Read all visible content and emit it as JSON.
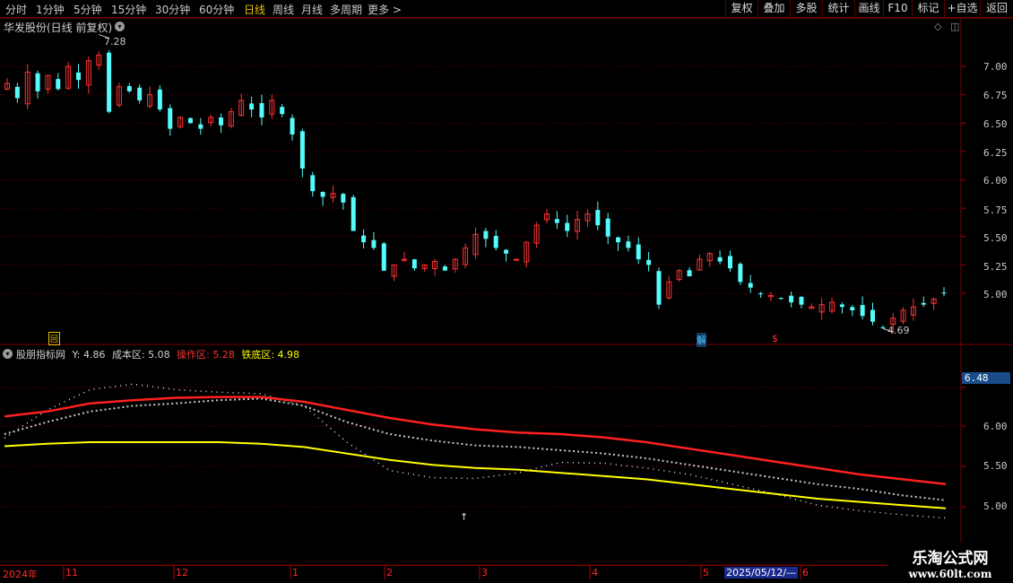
{
  "toolbar": {
    "periods": [
      "分时",
      "1分钟",
      "5分钟",
      "15分钟",
      "30分钟",
      "60分钟",
      "日线",
      "周线",
      "月线",
      "多周期",
      "更多 >"
    ],
    "active_period": "日线",
    "right_buttons": [
      "复权",
      "叠加",
      "多股",
      "统计",
      "画线",
      "F10",
      "标记",
      "+自选",
      "返回"
    ]
  },
  "chart_title": "华发股份(日线 前复权)",
  "price_axis": [
    "7.00",
    "6.75",
    "6.50",
    "6.25",
    "6.00",
    "5.75",
    "5.50",
    "5.25",
    "5.00"
  ],
  "annotations": {
    "high": "7.28",
    "low": "4.69",
    "marker_jie": "解",
    "marker_dollar": "$",
    "marker_box": "回"
  },
  "indicator": {
    "name": "股朋指标网",
    "y_label": "Y: 4.86",
    "cost_label": "成本区: 5.08",
    "op_label": "操作区: 5.28",
    "iron_label": "铁底区: 4.98",
    "axis": [
      "6.48",
      "6.00",
      "5.50",
      "5.00"
    ],
    "current_value": "6.48",
    "arrow": "↑"
  },
  "date_axis": {
    "labels": [
      "2024年",
      "11",
      "12",
      "1",
      "2",
      "3",
      "4",
      "5",
      "6"
    ],
    "cursor_date": "2025/05/12/—"
  },
  "watermark": {
    "line1": "乐淘公式网",
    "line2": "www.60lt.com"
  },
  "colors": {
    "up": "#ff3232",
    "down": "#54fcfc",
    "op_line": "#ff2020",
    "iron_line": "#ffff00",
    "grid": "#7a0000"
  },
  "chart_data": {
    "type": "candlestick",
    "title": "华发股份(日线 前复权)",
    "close_series": [
      6.85,
      6.72,
      6.95,
      6.78,
      6.92,
      6.8,
      7.0,
      6.88,
      7.05,
      7.1,
      6.6,
      6.82,
      6.78,
      6.7,
      6.75,
      6.62,
      6.45,
      6.55,
      6.5,
      6.45,
      6.55,
      6.48,
      6.6,
      6.7,
      6.62,
      6.55,
      6.7,
      6.58,
      6.4,
      6.1,
      5.9,
      5.85,
      5.88,
      5.8,
      5.55,
      5.45,
      5.4,
      5.2,
      5.25,
      5.3,
      5.22,
      5.25,
      5.28,
      5.2,
      5.3,
      5.4,
      5.52,
      5.48,
      5.4,
      5.35,
      5.3,
      5.45,
      5.6,
      5.7,
      5.62,
      5.55,
      5.65,
      5.7,
      5.6,
      5.5,
      5.45,
      5.4,
      5.3,
      5.25,
      4.9,
      5.1,
      5.2,
      5.15,
      5.3,
      5.35,
      5.28,
      5.22,
      5.1,
      5.05,
      5.0,
      4.98,
      4.95,
      4.92,
      4.9,
      4.88,
      4.9,
      4.92,
      4.88,
      4.85,
      4.8,
      4.75,
      4.7,
      4.78,
      4.85,
      4.88,
      4.9,
      4.95,
      5.0
    ],
    "high_label": 7.28,
    "low_label": 4.69,
    "ylim": [
      4.6,
      7.4
    ],
    "indicator_series": [
      {
        "name": "操作区",
        "last": 5.28
      },
      {
        "name": "成本区",
        "last": 5.08
      },
      {
        "name": "铁底区",
        "last": 4.98
      },
      {
        "name": "Y",
        "last": 4.86
      }
    ]
  }
}
